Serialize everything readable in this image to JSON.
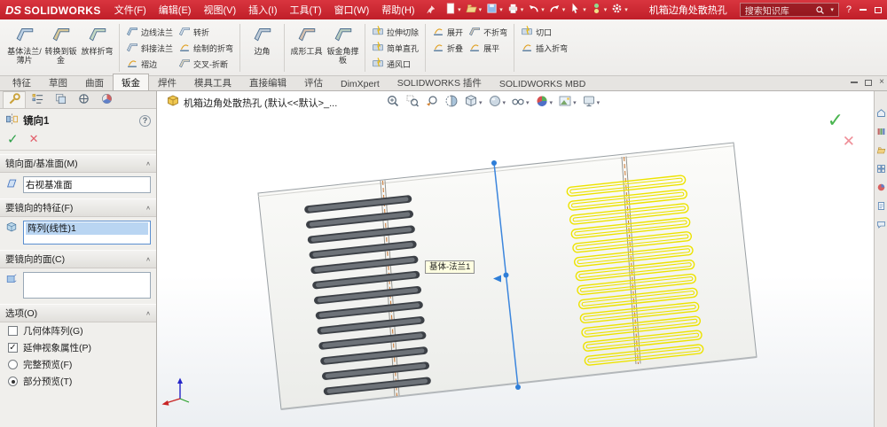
{
  "colors": {
    "titlebar_red": "#c9202b",
    "accent_blue": "#2f7ed8",
    "preview_yellow": "#ede300",
    "check_green": "#2da049",
    "cross_red": "#e2606c"
  },
  "titlebar": {
    "logo_ds": "DS",
    "logo_text": "SOLIDWORKS",
    "menus": [
      "文件(F)",
      "编辑(E)",
      "视图(V)",
      "插入(I)",
      "工具(T)",
      "窗口(W)",
      "帮助(H)"
    ],
    "quick_icons": [
      "new",
      "open",
      "save",
      "print",
      "undo",
      "redo",
      "select",
      "rebuild",
      "options"
    ],
    "doc_title": "机箱边角处散热孔",
    "search": {
      "placeholder": "搜索知识库"
    },
    "help_label": "?"
  },
  "ribbon": {
    "groups": [
      {
        "type": "large",
        "items": [
          {
            "label": "基体法兰/薄片",
            "icon": "base-flange"
          },
          {
            "label": "转换到钣金",
            "icon": "convert-to-sheet-metal"
          },
          {
            "label": "放样折弯",
            "icon": "lofted-bend"
          }
        ]
      },
      {
        "type": "small",
        "columns": [
          [
            {
              "label": "边线法兰",
              "icon": "edge-flange"
            },
            {
              "label": "斜接法兰",
              "icon": "miter-flange"
            },
            {
              "label": "褶边",
              "icon": "hem"
            }
          ],
          [
            {
              "label": "转折",
              "icon": "jog"
            },
            {
              "label": "绘制的折弯",
              "icon": "sketched-bend"
            },
            {
              "label": "交叉-折断",
              "icon": "cross-break"
            }
          ]
        ]
      },
      {
        "type": "large",
        "items": [
          {
            "label": "边角",
            "icon": "corners"
          }
        ]
      },
      {
        "type": "large",
        "items": [
          {
            "label": "成形工具",
            "icon": "forming-tool"
          },
          {
            "label": "钣金角撑板",
            "icon": "sheet-metal-gusset"
          }
        ]
      },
      {
        "type": "small",
        "columns": [
          [
            {
              "label": "拉伸切除",
              "icon": "extruded-cut"
            },
            {
              "label": "简单直孔",
              "icon": "simple-hole"
            },
            {
              "label": "通风口",
              "icon": "vent"
            }
          ]
        ]
      },
      {
        "type": "small",
        "columns": [
          [
            {
              "label": "展开",
              "icon": "unfold"
            },
            {
              "label": "折叠",
              "icon": "fold"
            }
          ],
          [
            {
              "label": "不折弯",
              "icon": "no-bends"
            },
            {
              "label": "展平",
              "icon": "flatten"
            }
          ]
        ]
      },
      {
        "type": "small",
        "columns": [
          [
            {
              "label": "切口",
              "icon": "rip"
            },
            {
              "label": "插入折弯",
              "icon": "insert-bends"
            }
          ]
        ]
      }
    ]
  },
  "tabs": {
    "items": [
      "特征",
      "草图",
      "曲面",
      "钣金",
      "焊件",
      "模具工具",
      "直接编辑",
      "评估",
      "DimXpert",
      "SOLIDWORKS 插件",
      "SOLIDWORKS MBD"
    ],
    "names": [
      "features",
      "sketch",
      "surfaces",
      "sheet-metal",
      "weldments",
      "mold-tools",
      "direct-editing",
      "evaluate",
      "dimxpert",
      "solidworks-addins",
      "solidworks-mbd"
    ],
    "active": "钣金"
  },
  "property_manager": {
    "tab_icons": [
      "property-manager",
      "feature-manager",
      "configuration-manager",
      "dimxpert-manager",
      "display-manager"
    ],
    "title": "镜向1",
    "help_icon": "?",
    "ok_label": "✓",
    "cancel_label": "✕",
    "sections": {
      "mirror_plane": {
        "title": "镜向面/基准面(M)",
        "value": "右视基准面"
      },
      "features": {
        "title": "要镜向的特征(F)",
        "value": "阵列(线性)1"
      },
      "faces": {
        "title": "要镜向的面(C)",
        "value": ""
      },
      "options": {
        "title": "选项(O)",
        "items": [
          {
            "label": "几何体阵列(G)",
            "type": "checkbox",
            "checked": false,
            "name": "geometry-pattern-checkbox"
          },
          {
            "label": "延伸视象属性(P)",
            "type": "checkbox",
            "checked": true,
            "name": "propagate-visual-properties-checkbox"
          },
          {
            "label": "完整预览(F)",
            "type": "radio",
            "checked": false,
            "name": "full-preview-radio"
          },
          {
            "label": "部分预览(T)",
            "type": "radio",
            "checked": true,
            "name": "partial-preview-radio"
          }
        ]
      }
    }
  },
  "viewport": {
    "tree_label": "机箱边角处散热孔 (默认<<默认>_...",
    "tooltip": "基体-法兰1",
    "headsup_icons": [
      "zoom-fit",
      "zoom-area",
      "previous-view",
      "section-view",
      "view-orientation",
      "display-style",
      "hide-show-items",
      "edit-appearance",
      "apply-scene",
      "view-settings"
    ],
    "confirm": {
      "ok": "✓",
      "cancel": "✕"
    }
  },
  "taskpane_icons": [
    "home",
    "design-library",
    "file-explorer",
    "view-palette",
    "appearances",
    "custom-properties",
    "forum"
  ]
}
